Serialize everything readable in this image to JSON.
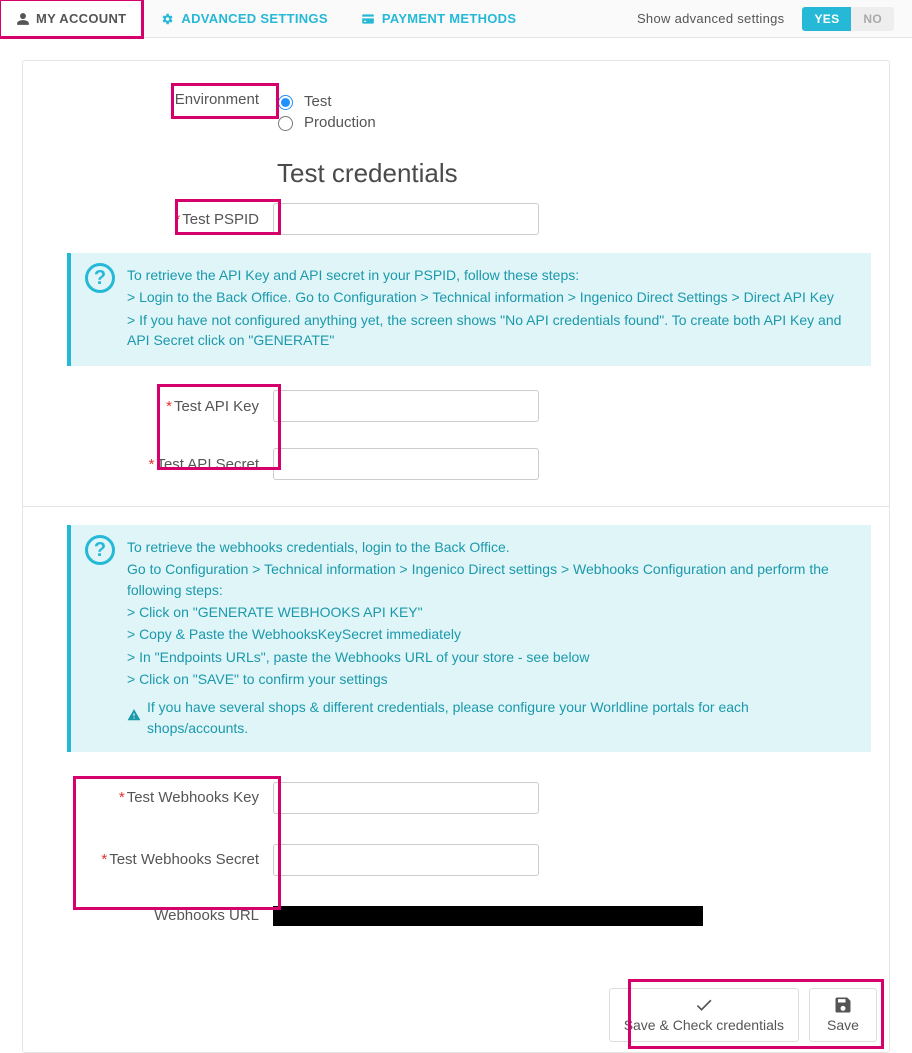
{
  "tabs": {
    "my_account": "MY ACCOUNT",
    "advanced_settings": "ADVANCED SETTINGS",
    "payment_methods": "PAYMENT METHODS"
  },
  "toggle": {
    "label": "Show advanced settings",
    "yes": "YES",
    "no": "NO"
  },
  "env": {
    "label": "Environment",
    "test": "Test",
    "production": "Production"
  },
  "section_title": "Test credentials",
  "fields": {
    "pspid": "Test PSPID",
    "api_key": "Test API Key",
    "api_secret": "Test API Secret",
    "wh_key": "Test Webhooks Key",
    "wh_secret": "Test Webhooks Secret",
    "wh_url": "Webhooks URL"
  },
  "callout_api": {
    "l1": "To retrieve the API Key and API secret in your PSPID, follow these steps:",
    "l2": "> Login to the Back Office. Go to Configuration > Technical information > Ingenico Direct Settings > Direct API Key",
    "l3": "> If you have not configured anything yet, the screen shows \"No API credentials found\". To create both API Key and API Secret click on \"GENERATE\""
  },
  "callout_wh": {
    "l1": "To retrieve the webhooks credentials, login to the Back Office.",
    "l2": "Go to Configuration > Technical information > Ingenico Direct settings > Webhooks Configuration and perform the following steps:",
    "l3": "> Click on \"GENERATE WEBHOOKS API KEY\"",
    "l4": "> Copy & Paste the WebhooksKeySecret immediately",
    "l5": "> In \"Endpoints URLs\", paste the Webhooks URL of your store - see below",
    "l6": "> Click on \"SAVE\" to confirm your settings",
    "warn": "If you have several shops & different credentials, please configure your Worldline portals for each shops/accounts."
  },
  "buttons": {
    "save_check": "Save & Check credentials",
    "save": "Save"
  }
}
